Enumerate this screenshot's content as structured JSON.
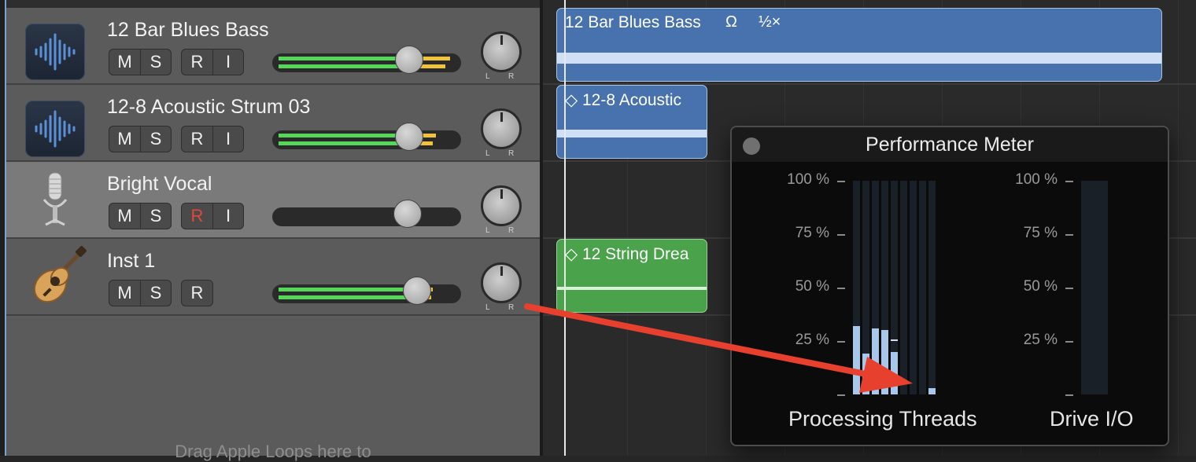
{
  "tracks": [
    {
      "name": "12 Bar Blues Bass",
      "icon": "waveform-icon",
      "buttons": [
        "M",
        "S",
        "R",
        "I"
      ],
      "record_armed": false,
      "volume": 0.72,
      "meter": 0.9
    },
    {
      "name": "12-8 Acoustic Strum 03",
      "icon": "waveform-icon",
      "buttons": [
        "M",
        "S",
        "R",
        "I"
      ],
      "record_armed": false,
      "volume": 0.72,
      "meter": 0.84
    },
    {
      "name": "Bright Vocal",
      "icon": "microphone-icon",
      "buttons": [
        "M",
        "S",
        "R",
        "I"
      ],
      "record_armed": true,
      "volume": 0.72,
      "meter": 0.0
    },
    {
      "name": "Inst 1",
      "icon": "acoustic-guitar-icon",
      "buttons": [
        "M",
        "S",
        "R"
      ],
      "record_armed": false,
      "volume": 0.76,
      "meter": 0.84
    }
  ],
  "knob_labels": {
    "left": "L",
    "right": "R"
  },
  "drag_hint": "Drag Apple Loops here to",
  "regions": [
    {
      "title": "12 Bar Blues Bass",
      "badge1": "Ω",
      "badge2": "½×",
      "color": "blue"
    },
    {
      "title": "◇ 12-8 Acoustic",
      "color": "blue"
    },
    {
      "title": "◇ 12 String Drea",
      "color": "green"
    }
  ],
  "performance_meter": {
    "title": "Performance Meter",
    "ticks": [
      "100 %",
      "75 %",
      "50 %",
      "25 %"
    ],
    "threads_label": "Processing Threads",
    "drive_label": "Drive I/O",
    "thread_levels": [
      0.32,
      0.19,
      0.31,
      0.3,
      0.2,
      0.0,
      0.0,
      0.0,
      0.03
    ],
    "thread_peaks": [
      null,
      null,
      null,
      null,
      0.25,
      null,
      null,
      null,
      null
    ],
    "drive_level": 0.0
  },
  "colors": {
    "accent_blue": "#4872ad",
    "region_green": "#4aa24a",
    "annotation_arrow": "#e8402e"
  }
}
